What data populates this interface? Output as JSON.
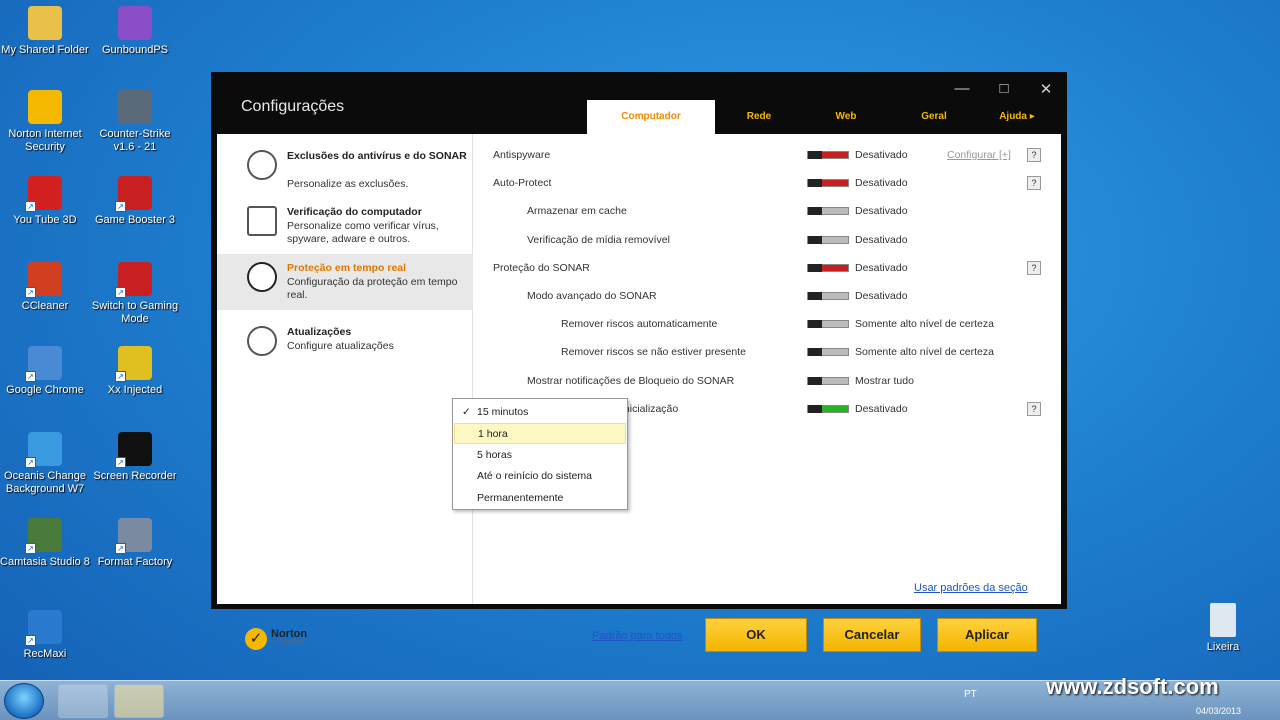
{
  "desktop": {
    "icons": [
      {
        "label": "My Shared Folder",
        "icon": "folder-icon",
        "color": "#e8c04a"
      },
      {
        "label": "GunboundPS",
        "icon": "game-icon",
        "color": "#8a4fc8"
      },
      {
        "label": "Norton Internet Security",
        "icon": "norton-icon",
        "color": "#f5b800"
      },
      {
        "label": "Counter-Strike v1.6 - 21",
        "icon": "counter-strike-icon",
        "color": "#5a6a7a"
      },
      {
        "label": "You Tube 3D",
        "icon": "youtube-icon",
        "color": "#d32020"
      },
      {
        "label": "Game Booster 3",
        "icon": "game-booster-icon",
        "color": "#c82020"
      },
      {
        "label": "CCleaner",
        "icon": "ccleaner-icon",
        "color": "#d04020"
      },
      {
        "label": "Switch to Gaming Mode",
        "icon": "gaming-mode-icon",
        "color": "#c82020"
      },
      {
        "label": "Google Chrome",
        "icon": "chrome-icon",
        "color": "#4a8ad4"
      },
      {
        "label": "Xx Injected",
        "icon": "injector-icon",
        "color": "#e0c020"
      },
      {
        "label": "Oceanis Change Background W7",
        "icon": "oceanis-icon",
        "color": "#3a9ae0"
      },
      {
        "label": "Screen Recorder",
        "icon": "screen-recorder-icon",
        "color": "#101010"
      },
      {
        "label": "Camtasia Studio 8",
        "icon": "camtasia-icon",
        "color": "#4a7a3a"
      },
      {
        "label": "Format Factory",
        "icon": "format-factory-icon",
        "color": "#7a8aa0"
      },
      {
        "label": "RecMaxi",
        "icon": "recmaxi-icon",
        "color": "#2a7ad0"
      }
    ],
    "recycle_bin": "Lixeira"
  },
  "window": {
    "title": "Configurações",
    "controls": [
      "—",
      "□",
      "✕"
    ],
    "tabs": [
      "Computador",
      "Rede",
      "Web",
      "Geral",
      "Ajuda ▸"
    ],
    "active_tab": "Computador",
    "accent": "#f5b800"
  },
  "sidebar": {
    "items": [
      {
        "title": "Exclusões do antivírus e do SONAR",
        "desc": "Personalize as exclusões.",
        "icon": "gauge-icon"
      },
      {
        "title": "Verificação do computador",
        "desc": "Personalize como verificar vírus, spyware, adware e outros.",
        "icon": "computer-icon"
      },
      {
        "title": "Proteção em tempo real",
        "desc": "Configuração da proteção em tempo real.",
        "icon": "clock-icon"
      },
      {
        "title": "Atualizações",
        "desc": "Configure atualizações",
        "icon": "globe-icon"
      }
    ]
  },
  "settings": {
    "configure_label": "Configurar [+]",
    "help_label": "?",
    "rows": [
      {
        "label": "Antispyware",
        "state": "Desativado",
        "toggle": "red"
      },
      {
        "label": "Auto-Protect",
        "state": "Desativado",
        "toggle": "red"
      },
      {
        "label": "Armazenar em cache",
        "state": "Desativado",
        "toggle": "grey"
      },
      {
        "label": "Verificação de mídia removível",
        "state": "Desativado",
        "toggle": "grey"
      },
      {
        "label": "Proteção do SONAR",
        "state": "Desativado",
        "toggle": "red"
      },
      {
        "label": "Modo avançado do SONAR",
        "state": "Desativado",
        "toggle": "grey"
      },
      {
        "label": "Remover riscos automaticamente",
        "state": "Somente alto nível de certeza",
        "toggle": "grey"
      },
      {
        "label": "Remover riscos se não estiver presente",
        "state": "Somente alto nível de certeza",
        "toggle": "grey"
      },
      {
        "label": "Mostrar notificações de Bloqueio do SONAR",
        "state": "Mostrar tudo",
        "toggle": "grey"
      },
      {
        "label": "de inicialização",
        "state": "Desativado",
        "toggle": "green"
      }
    ]
  },
  "dropdown": {
    "items": [
      "15 minutos",
      "1 hora",
      "5 horas",
      "Até o reinício do sistema",
      "Permanentemente"
    ],
    "checked": "15 minutos",
    "highlighted": "1 hora"
  },
  "footer": {
    "reset_section_link": "Usar padrões da seção",
    "reset_all_link": "Padrão para todos",
    "ok": "OK",
    "cancel": "Cancelar",
    "apply": "Aplicar",
    "logo": "Norton",
    "logo_sub": "by Symantec"
  },
  "taskbar": {
    "language": "PT",
    "date": "04/03/2013",
    "watermark": "www.zdsoft.com"
  }
}
